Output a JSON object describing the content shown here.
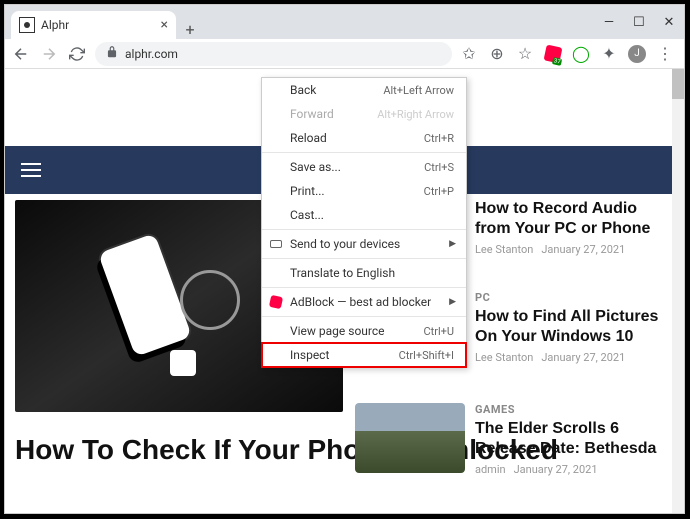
{
  "browser": {
    "tab_title": "Alphr",
    "url": "alphr.com",
    "window_controls": {
      "min": "—",
      "max": "☐",
      "close": "✕"
    },
    "avatar_letter": "J"
  },
  "context_menu": {
    "back": {
      "label": "Back",
      "shortcut": "Alt+Left Arrow"
    },
    "forward": {
      "label": "Forward",
      "shortcut": "Alt+Right Arrow"
    },
    "reload": {
      "label": "Reload",
      "shortcut": "Ctrl+R"
    },
    "save_as": {
      "label": "Save as...",
      "shortcut": "Ctrl+S"
    },
    "print": {
      "label": "Print...",
      "shortcut": "Ctrl+P"
    },
    "cast": {
      "label": "Cast..."
    },
    "send": {
      "label": "Send to your devices"
    },
    "translate": {
      "label": "Translate to English"
    },
    "adblock": {
      "label": "AdBlock — best ad blocker"
    },
    "view_source": {
      "label": "View page source",
      "shortcut": "Ctrl+U"
    },
    "inspect": {
      "label": "Inspect",
      "shortcut": "Ctrl+Shift+I"
    }
  },
  "page": {
    "hero_headline": "How To Check If Your Phone is Unlocked",
    "articles": [
      {
        "title": "How to Record Audio from Your PC or Phone",
        "author": "Lee Stanton",
        "date": "January 27, 2021"
      },
      {
        "category": "PC",
        "title": "How to Find All Pictures On Your Windows 10",
        "author": "Lee Stanton",
        "date": "January 27, 2021"
      },
      {
        "category": "GAMES",
        "title": "The Elder Scrolls 6 Release Date: Bethesda",
        "author": "admin",
        "date": "January 27, 2021"
      }
    ]
  }
}
